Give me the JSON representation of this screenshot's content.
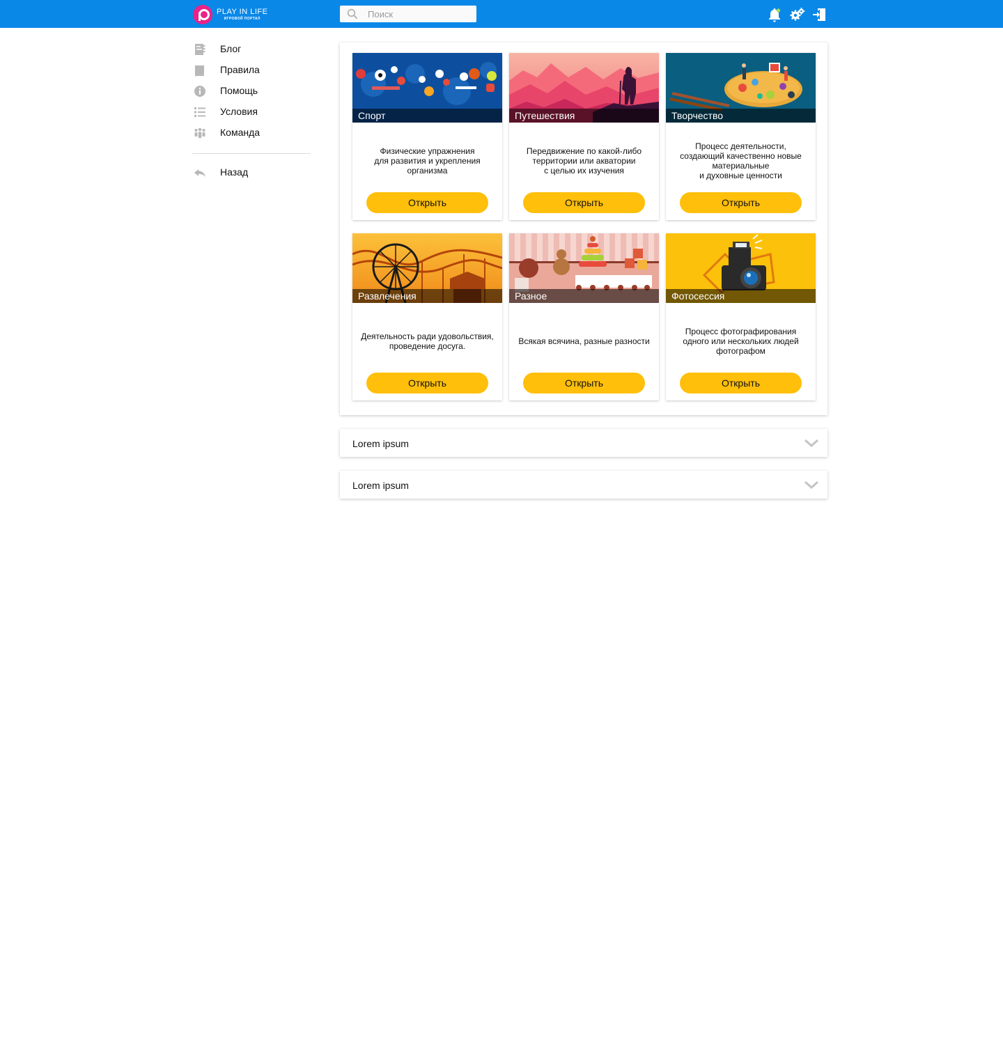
{
  "header": {
    "logo_title": "PLAY IN LIFE",
    "logo_subtitle": "ИГРОВОЙ ПОРТАЛ",
    "search_placeholder": "Поиск",
    "search_value": ""
  },
  "colors": {
    "header_bg": "#0a88e8",
    "accent_button": "#ffbf0a",
    "logo_pink": "#e8238a",
    "sidebar_icon": "#b8b8b8"
  },
  "sidebar": {
    "items": [
      {
        "label": "Блог",
        "icon": "blog-icon"
      },
      {
        "label": "Правила",
        "icon": "book-icon"
      },
      {
        "label": "Помощь",
        "icon": "info-icon"
      },
      {
        "label": "Условия",
        "icon": "list-icon"
      },
      {
        "label": "Команда",
        "icon": "team-icon"
      }
    ],
    "back": {
      "label": "Назад",
      "icon": "reply-icon"
    }
  },
  "cards": [
    {
      "title": "Спорт",
      "description": "Физические упражнения\nдля развития и укрепления\nорганизма",
      "button": "Открыть"
    },
    {
      "title": "Путешествия",
      "description": "Передвижение по какой-либо\nтерритории или акватории\nс целью их изучения",
      "button": "Открыть"
    },
    {
      "title": "Творчество",
      "description": "Процесс деятельности,\nсоздающий качественно новые\nматериальные\nи духовные ценности",
      "button": "Открыть"
    },
    {
      "title": "Развлечения",
      "description": "Деятельность ради удовольствия,\nпроведение досуга.",
      "button": "Открыть"
    },
    {
      "title": "Разное",
      "description": "Всякая всячина, разные разности",
      "button": "Открыть"
    },
    {
      "title": "Фотосессия",
      "description": "Процесс фотографирования\nодного или нескольких людей\nфотографом",
      "button": "Открыть"
    }
  ],
  "accordions": [
    {
      "label": "Lorem ipsum"
    },
    {
      "label": "Lorem ipsum"
    }
  ]
}
